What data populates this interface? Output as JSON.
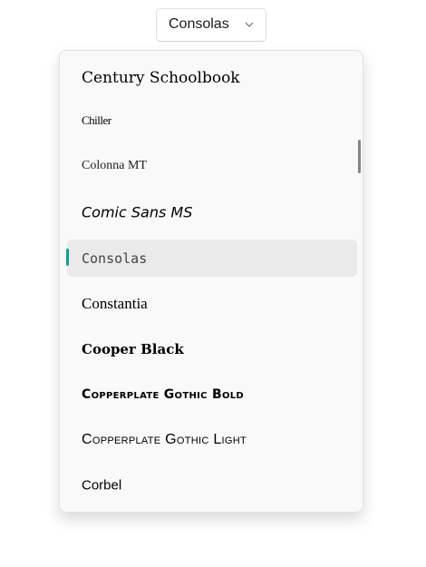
{
  "combo": {
    "selected": "Consolas",
    "icon": "chevron-down-icon"
  },
  "dropdown": {
    "items": [
      {
        "label": "Century Schoolbook"
      },
      {
        "label": "Chiller"
      },
      {
        "label": "Colonna MT"
      },
      {
        "label": "Comic Sans MS"
      },
      {
        "label": "Consolas",
        "selected": true
      },
      {
        "label": "Constantia"
      },
      {
        "label": "Cooper Black"
      },
      {
        "label": "Copperplate Gothic Bold"
      },
      {
        "label": "Copperplate Gothic Light"
      },
      {
        "label": "Corbel"
      }
    ]
  },
  "colors": {
    "accent": "#0f9da6",
    "selected_bg": "#eaeaea",
    "panel_bg": "#f9f9f9"
  }
}
